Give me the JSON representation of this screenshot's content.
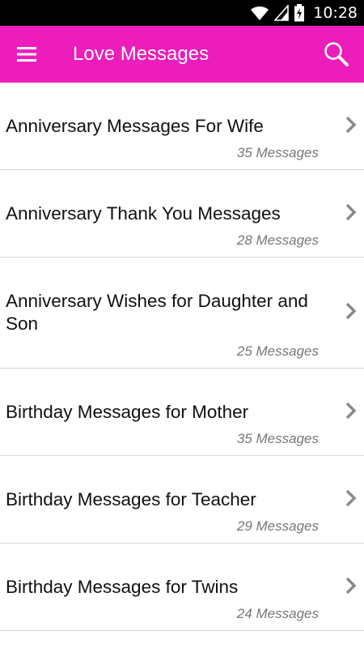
{
  "status_bar": {
    "time": "10:28",
    "icons": [
      "wifi-icon",
      "signal-icon",
      "battery-charging-icon"
    ]
  },
  "app_bar": {
    "title": "Love Messages",
    "menu_icon": "hamburger-menu-icon",
    "search_icon": "search-icon",
    "background_color": "#ec1dbb"
  },
  "categories": [
    {
      "title": "Anniversary Messages For Wife",
      "count": "35 Messages"
    },
    {
      "title": "Anniversary Thank You Messages",
      "count": "28 Messages"
    },
    {
      "title": "Anniversary Wishes for Daughter and Son",
      "count": "25 Messages"
    },
    {
      "title": "Birthday Messages for Mother",
      "count": "35 Messages"
    },
    {
      "title": "Birthday Messages for Teacher",
      "count": "29 Messages"
    },
    {
      "title": "Birthday Messages for Twins",
      "count": "24 Messages"
    }
  ]
}
